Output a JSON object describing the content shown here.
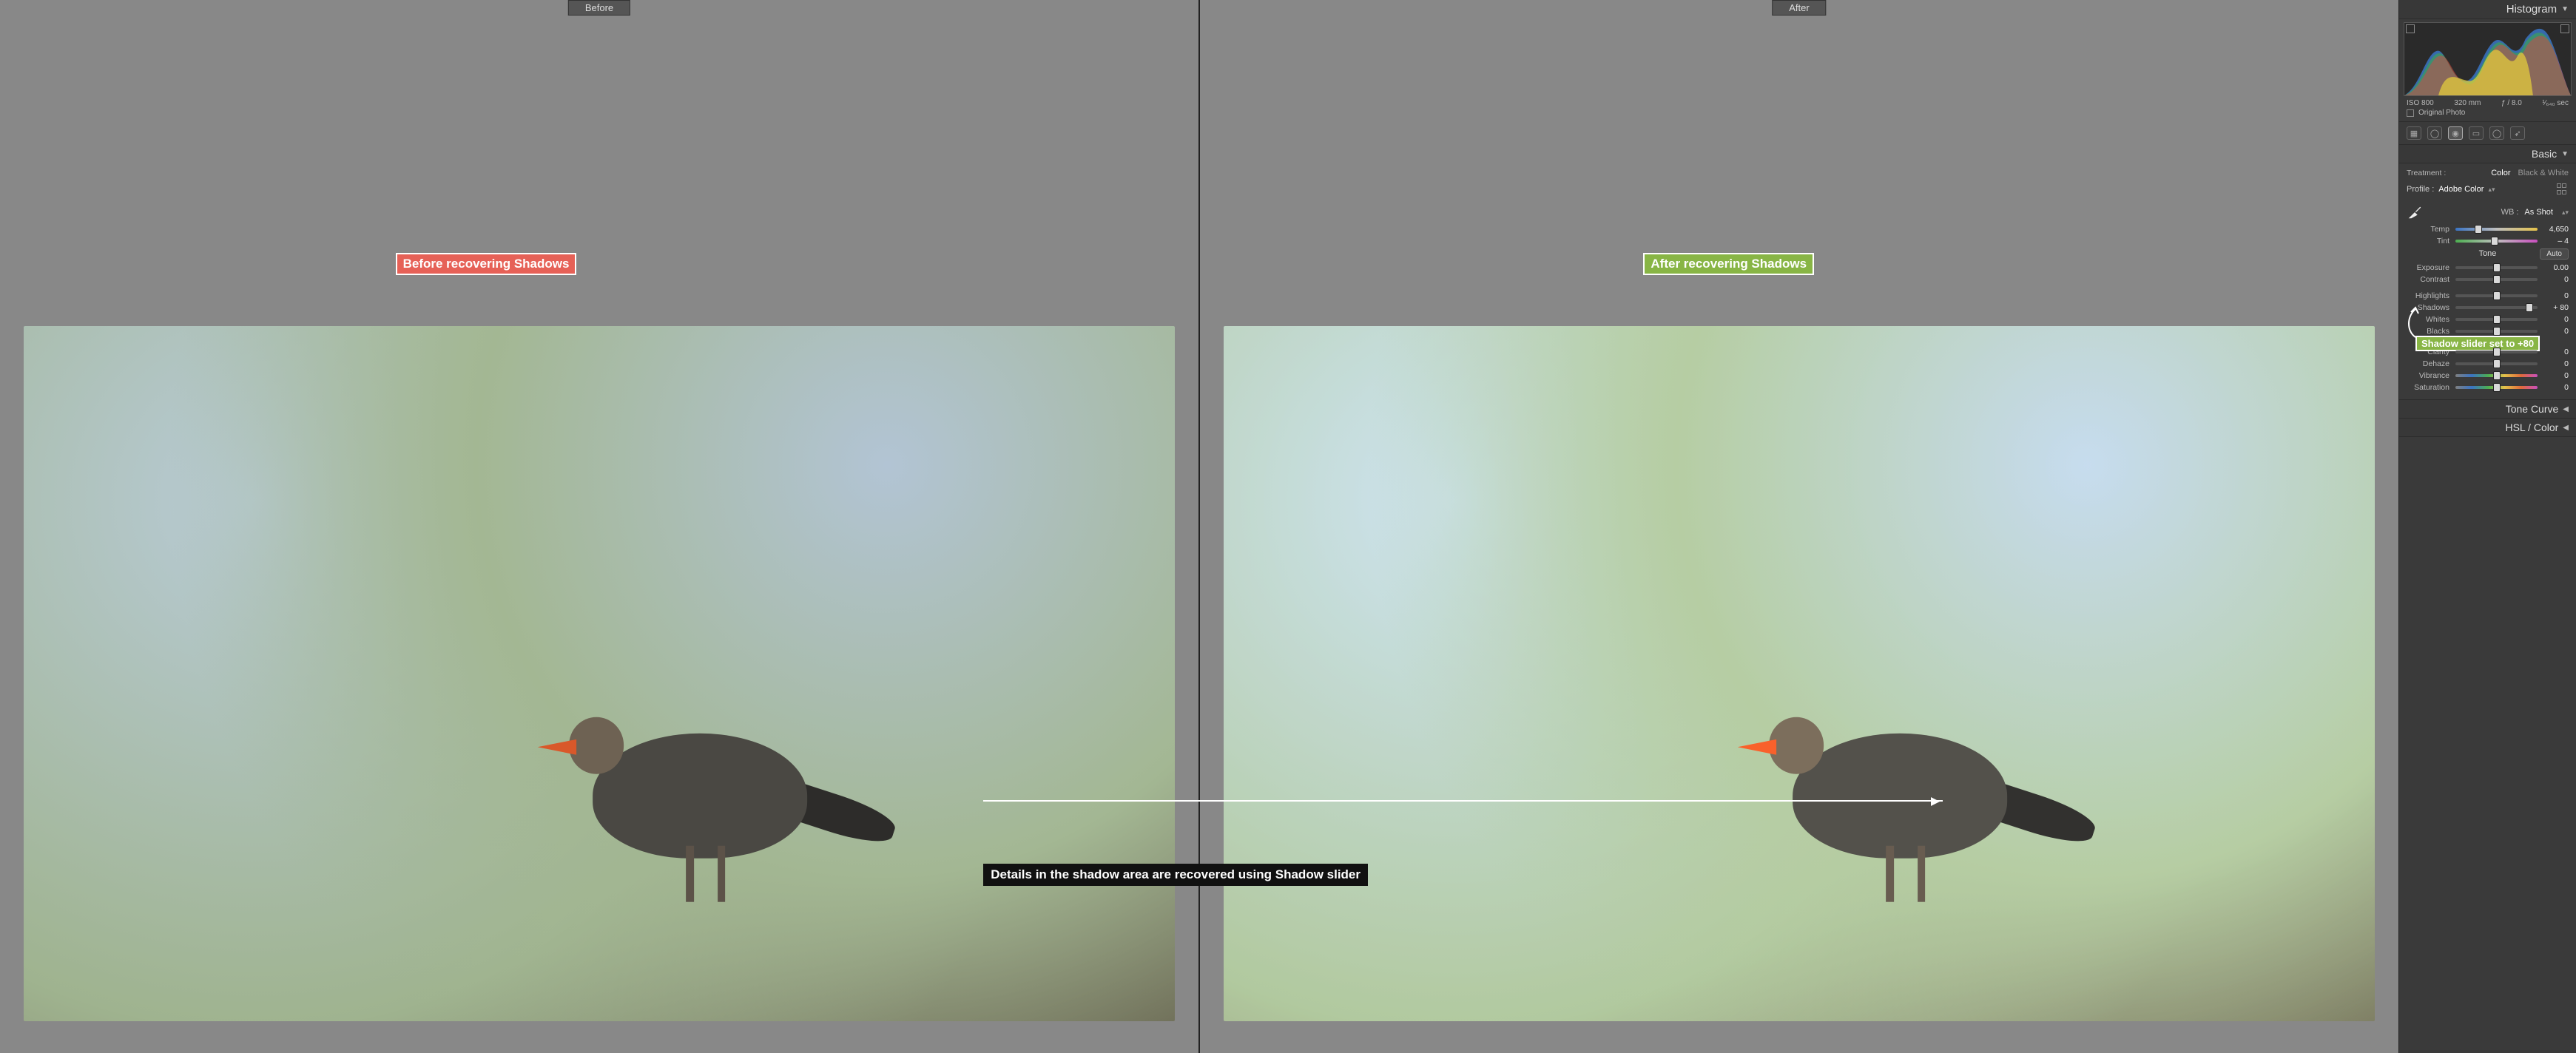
{
  "viewport": {
    "before_label": "Before",
    "after_label": "After",
    "annot_before": "Before recovering Shadows",
    "annot_after": "After recovering Shadows",
    "annot_detail": "Details in the shadow area are recovered using Shadow slider",
    "annot_slider": "Shadow slider set to +80"
  },
  "panel": {
    "histogram_title": "Histogram",
    "meta": {
      "iso": "ISO 800",
      "focal": "320 mm",
      "aperture": "ƒ / 8.0",
      "shutter": "¹⁄₆₄₀ sec"
    },
    "original_photo": "Original Photo",
    "basic_title": "Basic",
    "treatment_label": "Treatment :",
    "treatment_color": "Color",
    "treatment_bw": "Black & White",
    "profile_label": "Profile :",
    "profile_value": "Adobe Color",
    "wb_label": "WB :",
    "wb_value": "As Shot",
    "sliders": {
      "temp": {
        "label": "Temp",
        "value": "4,650",
        "pos": 28
      },
      "tint": {
        "label": "Tint",
        "value": "– 4",
        "pos": 48
      },
      "tone_title": "Tone",
      "auto": "Auto",
      "exposure": {
        "label": "Exposure",
        "value": "0.00",
        "pos": 50
      },
      "contrast": {
        "label": "Contrast",
        "value": "0",
        "pos": 50
      },
      "highlights": {
        "label": "Highlights",
        "value": "0",
        "pos": 50
      },
      "shadows": {
        "label": "Shadows",
        "value": "+ 80",
        "pos": 90
      },
      "whites": {
        "label": "Whites",
        "value": "0",
        "pos": 50
      },
      "blacks": {
        "label": "Blacks",
        "value": "0",
        "pos": 50
      },
      "clarity": {
        "label": "Clarity",
        "value": "0",
        "pos": 50
      },
      "dehaze": {
        "label": "Dehaze",
        "value": "0",
        "pos": 50
      },
      "vibrance": {
        "label": "Vibrance",
        "value": "0",
        "pos": 50
      },
      "saturation": {
        "label": "Saturation",
        "value": "0",
        "pos": 50
      }
    },
    "tone_curve_title": "Tone Curve",
    "hsl_title": "HSL / Color"
  }
}
